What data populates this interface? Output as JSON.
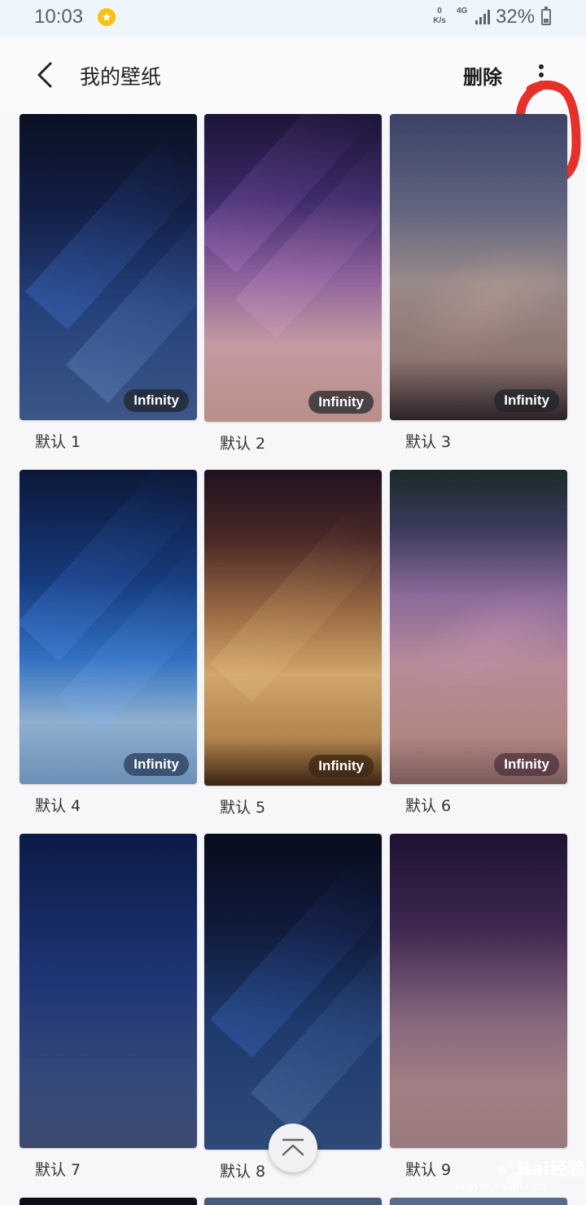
{
  "status_bar": {
    "time": "10:03",
    "net_speed_value": "0",
    "net_speed_unit": "K/s",
    "network_type": "4G",
    "battery_percent": "32%",
    "battery_level": 0.32
  },
  "app_bar": {
    "title": "我的壁纸",
    "delete_label": "删除",
    "back_icon": "chevron-left-icon",
    "more_icon": "more-vert-icon"
  },
  "wallpapers": [
    {
      "label": "默认 1",
      "badge": "Infinity"
    },
    {
      "label": "默认 2",
      "badge": "Infinity"
    },
    {
      "label": "默认 3",
      "badge": "Infinity"
    },
    {
      "label": "默认 4",
      "badge": "Infinity"
    },
    {
      "label": "默认 5",
      "badge": "Infinity"
    },
    {
      "label": "默认 6",
      "badge": "Infinity"
    },
    {
      "label": "默认 7",
      "badge": ""
    },
    {
      "label": "默认 8",
      "badge": ""
    },
    {
      "label": "默认 9",
      "badge": ""
    }
  ],
  "scroll_top_icon": "chevron-up-icon",
  "watermark": {
    "main": "Bai经验",
    "sub": "jingyan.baidu.com"
  },
  "colors": {
    "annotation": "#e8302a",
    "badge_bg": "#1e2228"
  }
}
